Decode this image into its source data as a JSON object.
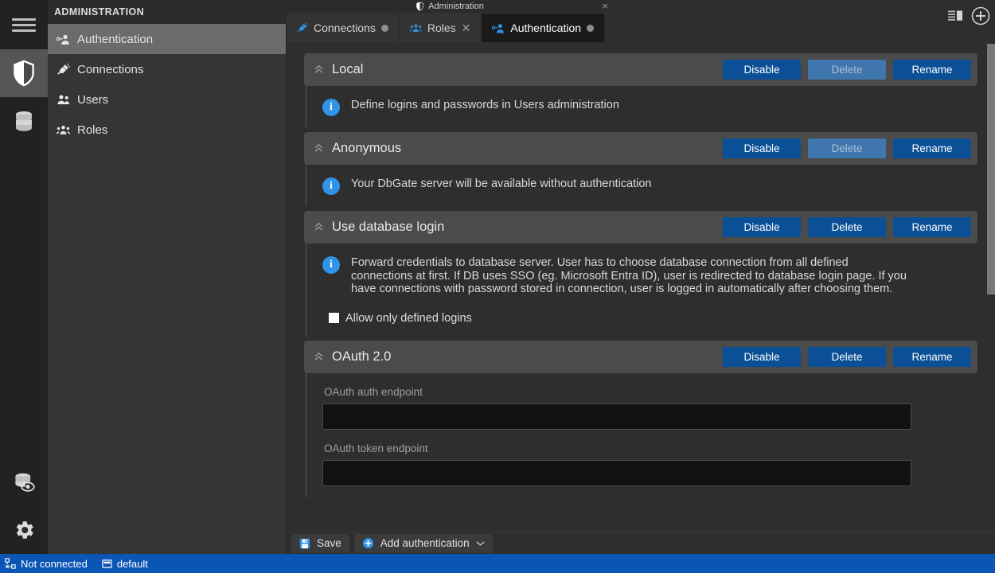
{
  "colors": {
    "accent": "#0b4f96",
    "status_bar": "#0b55b5",
    "info_icon": "#2f93e8",
    "section_header": "#4b4b4b",
    "sidebar_selected": "#6b6b6b"
  },
  "rail": {
    "items": [
      {
        "name": "hamburger-menu",
        "icon": "hamburger-icon",
        "active": false
      },
      {
        "name": "administration",
        "icon": "shield-icon",
        "active": true
      },
      {
        "name": "databases",
        "icon": "database-icon",
        "active": false
      },
      {
        "name": "db-preview",
        "icon": "database-eye-icon",
        "active": false
      },
      {
        "name": "settings",
        "icon": "gear-icon",
        "active": false
      }
    ]
  },
  "sidebar": {
    "title": "ADMINISTRATION",
    "items": [
      {
        "label": "Authentication",
        "icon": "user-key-icon",
        "selected": true
      },
      {
        "label": "Connections",
        "icon": "plug-icon",
        "selected": false
      },
      {
        "label": "Users",
        "icon": "users-icon",
        "selected": false
      },
      {
        "label": "Roles",
        "icon": "roles-icon",
        "selected": false
      }
    ]
  },
  "window": {
    "title": "Administration",
    "icon": "shield-icon",
    "close_label": "×"
  },
  "tabs": [
    {
      "label": "Connections",
      "icon": "plug-icon",
      "active": false,
      "indicator": "dot"
    },
    {
      "label": "Roles",
      "icon": "roles-icon",
      "active": false,
      "indicator": "close"
    },
    {
      "label": "Authentication",
      "icon": "user-key-icon",
      "active": true,
      "indicator": "dot"
    }
  ],
  "topright": [
    {
      "name": "layout-panels-icon",
      "label": ""
    },
    {
      "name": "add-circle-icon",
      "label": "+"
    }
  ],
  "sections": [
    {
      "title": "Local",
      "buttons": [
        {
          "label": "Disable",
          "disabled": false
        },
        {
          "label": "Delete",
          "disabled": true
        },
        {
          "label": "Rename",
          "disabled": false
        }
      ],
      "info": "Define logins and passwords in Users administration"
    },
    {
      "title": "Anonymous",
      "buttons": [
        {
          "label": "Disable",
          "disabled": false
        },
        {
          "label": "Delete",
          "disabled": true
        },
        {
          "label": "Rename",
          "disabled": false
        }
      ],
      "info": "Your DbGate server will be available without authentication"
    },
    {
      "title": "Use database login",
      "buttons": [
        {
          "label": "Disable",
          "disabled": false
        },
        {
          "label": "Delete",
          "disabled": false
        },
        {
          "label": "Rename",
          "disabled": false
        }
      ],
      "info": "Forward credentials to database server. User has to choose database connection from all defined connections at first. If DB uses SSO (eg. Microsoft Entra ID), user is redirected to database login page. If you have connections with password stored in connection, user is logged in automatically after choosing them.",
      "checkbox": {
        "label": "Allow only defined logins",
        "checked": false
      }
    },
    {
      "title": "OAuth 2.0",
      "buttons": [
        {
          "label": "Disable",
          "disabled": false
        },
        {
          "label": "Delete",
          "disabled": false
        },
        {
          "label": "Rename",
          "disabled": false
        }
      ],
      "fields": [
        {
          "label": "OAuth auth endpoint",
          "value": "",
          "placeholder": ""
        },
        {
          "label": "OAuth token endpoint",
          "value": "",
          "placeholder": ""
        }
      ]
    }
  ],
  "toolbar": {
    "save_label": "Save",
    "save_icon": "save-icon",
    "add_label": "Add authentication",
    "add_icon": "plus-circle-icon",
    "add_caret": "⌄"
  },
  "status": {
    "connection_label": "Not connected",
    "connection_icon": "disconnected-icon",
    "database_label": "default",
    "database_icon": "database-small-icon"
  }
}
